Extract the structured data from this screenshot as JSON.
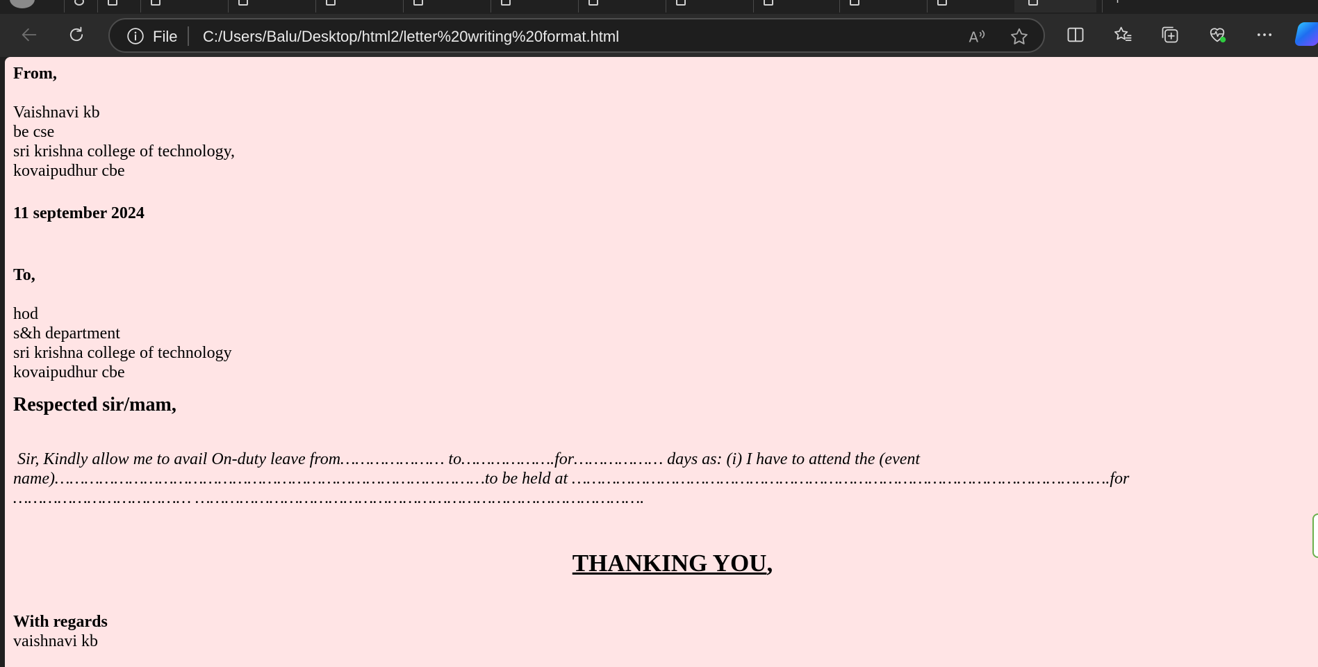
{
  "browser": {
    "address_bar": {
      "scheme_label": "File",
      "url": "C:/Users/Balu/Desktop/html2/letter%20writing%20format.html"
    },
    "icons": {
      "back": "back-arrow-icon",
      "refresh": "refresh-icon",
      "site_info": "info-icon",
      "read_aloud": "read-aloud-icon",
      "favorite": "star-icon",
      "split_screen": "split-screen-icon",
      "favorites": "favorites-icon",
      "collections": "collections-icon",
      "performance": "heartbeat-icon",
      "menu": "more-dots-icon",
      "copilot": "copilot-icon"
    },
    "colors": {
      "chrome_bg": "#202020",
      "toolbar_bg": "#2b2b2b",
      "page_bg": "#ffe4e5",
      "health_badge": "#2ecc40"
    }
  },
  "letter": {
    "from_label": "From,",
    "sender": [
      "Vaishnavi kb",
      "be cse",
      "sri krishna college of technology,",
      "kovaipudhur cbe"
    ],
    "date": "11 september 2024",
    "to_label": "To,",
    "recipient": [
      "hod",
      "s&h department",
      "sri krishna college of technology",
      "kovaipudhur cbe"
    ],
    "salutation": "Respected sir/mam,",
    "body_lines": [
      " Sir, Kindly allow me to avail On-duty leave from………………… to……………….for……………… days as: (i) I have to attend the (event",
      "name)……………………………………………………………………………to be held at ……………………………………………………………………………………………….for",
      "……………………………… ………………………………………………………………………………."
    ],
    "closing": "THANKING YOU",
    "closing_punct": ",",
    "regards_label": "With regards",
    "signature": "vaishnavi kb"
  }
}
